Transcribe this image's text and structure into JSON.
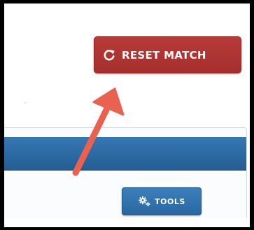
{
  "reset_button": {
    "label": "RESET MATCH",
    "icon": "refresh-icon",
    "color": "#b0352f"
  },
  "panel": {
    "header_color": "#2d6aa6"
  },
  "tools_button": {
    "label": "TOOLS",
    "icon": "gears-icon",
    "color": "#3274b0"
  },
  "annotation": {
    "arrow_color": "#e8624f"
  }
}
